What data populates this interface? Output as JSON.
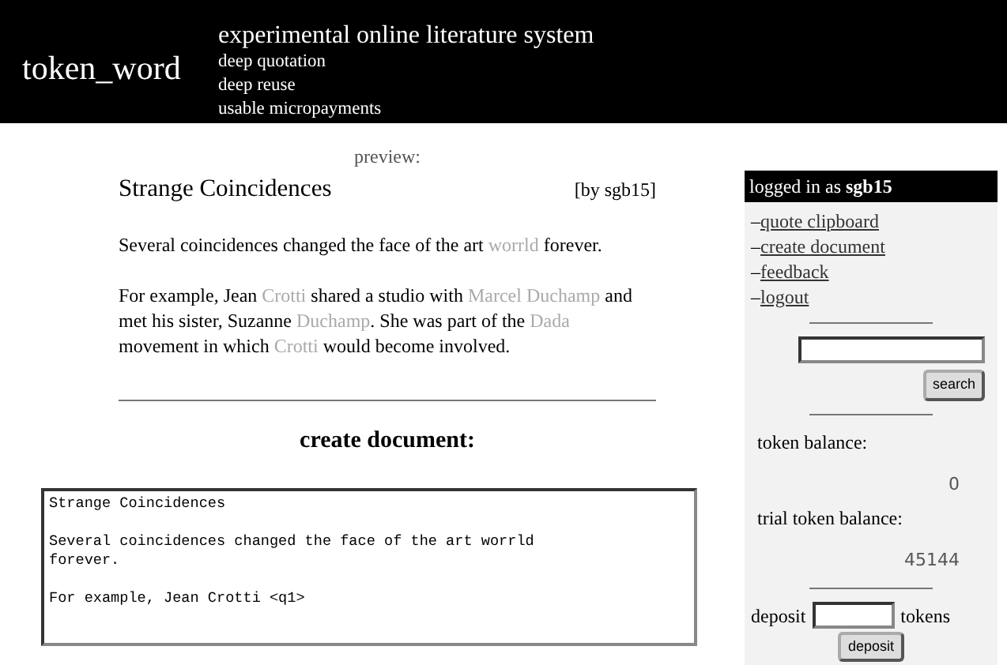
{
  "header": {
    "logo": "token_word",
    "tagline": "experimental online literature system",
    "features": [
      "deep quotation",
      "deep reuse",
      "usable micropayments"
    ]
  },
  "preview": {
    "label": "preview:",
    "title": "Strange Coincidences",
    "byline": "[by sgb15]",
    "paragraphs": [
      [
        {
          "text": "Several coincidences changed the face of the art ",
          "quoted": false
        },
        {
          "text": "worrld",
          "quoted": true
        },
        {
          "text": " forever.",
          "quoted": false
        }
      ],
      [
        {
          "text": "For example, Jean ",
          "quoted": false
        },
        {
          "text": "Crotti",
          "quoted": true
        },
        {
          "text": " shared a studio with ",
          "quoted": false
        },
        {
          "text": "Marcel Duchamp",
          "quoted": true
        },
        {
          "text": " and met his sister, Suzanne ",
          "quoted": false
        },
        {
          "text": "Duchamp",
          "quoted": true
        },
        {
          "text": ". She was part of the ",
          "quoted": false
        },
        {
          "text": "Dada",
          "quoted": true
        },
        {
          "text": " movement in which ",
          "quoted": false
        },
        {
          "text": "Crotti",
          "quoted": true
        },
        {
          "text": " would become involved.",
          "quoted": false
        }
      ]
    ]
  },
  "create": {
    "heading": "create document:",
    "editor_paragraphs": [
      "Strange Coincidences",
      "Several coincidences changed the face of the art worrld\nforever.",
      "For example, Jean Crotti <q1>"
    ]
  },
  "sidebar": {
    "login": "logged in as **sgb15**",
    "links": [
      "quote clipboard",
      "create document",
      "feedback",
      "logout"
    ],
    "link_dash": "–",
    "search_button": "search",
    "token_balance_label": "token balance:",
    "token_balance": "0",
    "trial_balance_label": "trial token balance:",
    "trial_balance": "45144",
    "deposit_label": "deposit",
    "deposit_unit": "tokens",
    "deposit_button": "deposit"
  }
}
